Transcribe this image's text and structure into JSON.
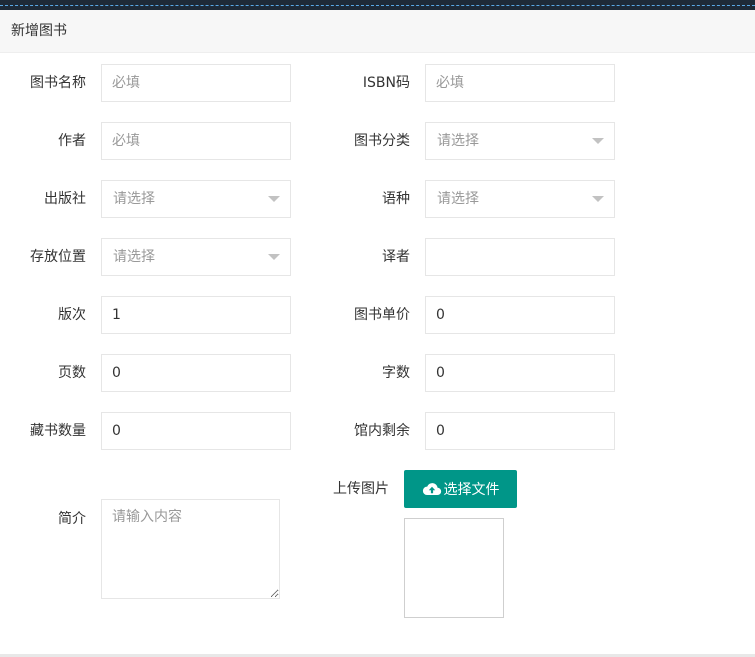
{
  "card": {
    "title": "新增图书"
  },
  "form": {
    "book_name": {
      "label": "图书名称",
      "placeholder": "必填",
      "value": ""
    },
    "isbn": {
      "label": "ISBN码",
      "placeholder": "必填",
      "value": ""
    },
    "author": {
      "label": "作者",
      "placeholder": "必填",
      "value": ""
    },
    "category": {
      "label": "图书分类",
      "selected": "请选择"
    },
    "publisher": {
      "label": "出版社",
      "selected": "请选择"
    },
    "language": {
      "label": "语种",
      "selected": "请选择"
    },
    "location": {
      "label": "存放位置",
      "selected": "请选择"
    },
    "translator": {
      "label": "译者",
      "value": ""
    },
    "edition": {
      "label": "版次",
      "value": "1"
    },
    "price": {
      "label": "图书单价",
      "value": "0"
    },
    "pages": {
      "label": "页数",
      "value": "0"
    },
    "word_count": {
      "label": "字数",
      "value": "0"
    },
    "collection_count": {
      "label": "藏书数量",
      "value": "0"
    },
    "remaining": {
      "label": "馆内剩余",
      "value": "0"
    },
    "summary": {
      "label": "简介",
      "placeholder": "请输入内容",
      "value": ""
    },
    "upload": {
      "label": "上传图片",
      "button_label": "选择文件",
      "icon": "cloud-upload-icon"
    }
  },
  "colors": {
    "accent": "#009688",
    "header_bg": "#f7f7f7",
    "border": "#e6e6e6"
  }
}
